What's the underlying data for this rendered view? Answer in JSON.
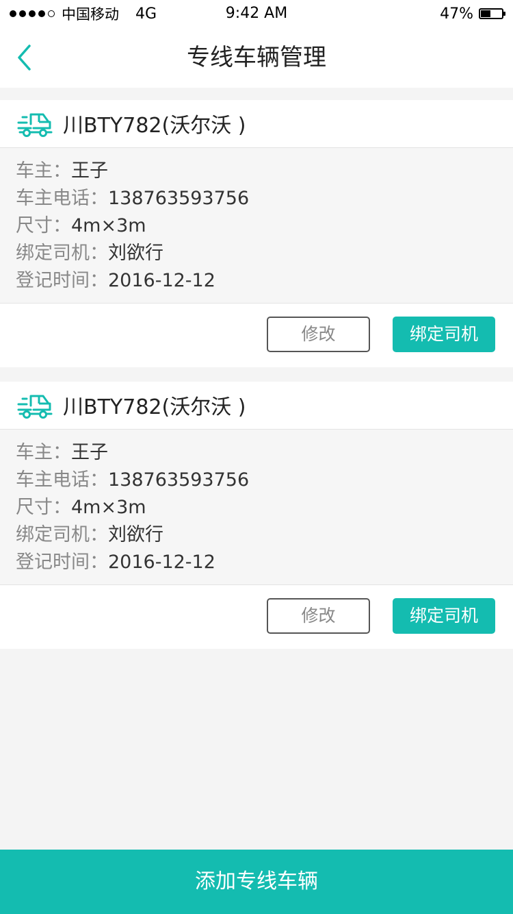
{
  "status_bar": {
    "carrier": "中国移动",
    "network": "4G",
    "time": "9:42 AM",
    "battery": "47%",
    "battery_level": 0.47,
    "signal_bars": 4,
    "signal_max": 5
  },
  "nav": {
    "back_icon": "chevron-left-icon",
    "title": "专线车辆管理"
  },
  "colors": {
    "accent": "#14bcb0",
    "page_background": "#f4f4f4"
  },
  "vehicles": [
    {
      "icon": "truck-icon",
      "plate": "川BTY782(沃尔沃 )",
      "fields": [
        {
          "label": "车主：",
          "value": "王子"
        },
        {
          "label": "车主电话：",
          "value": "138763593756"
        },
        {
          "label": "尺寸：",
          "value": "4m×3m"
        },
        {
          "label": "绑定司机：",
          "value": "刘欲行"
        },
        {
          "label": "登记时间：",
          "value": "2016-12-12"
        }
      ],
      "edit_label": "修改",
      "bind_label": "绑定司机"
    },
    {
      "icon": "truck-icon",
      "plate": "川BTY782(沃尔沃 )",
      "fields": [
        {
          "label": "车主：",
          "value": "王子"
        },
        {
          "label": "车主电话：",
          "value": "138763593756"
        },
        {
          "label": "尺寸：",
          "value": "4m×3m"
        },
        {
          "label": "绑定司机：",
          "value": "刘欲行"
        },
        {
          "label": "登记时间：",
          "value": "2016-12-12"
        }
      ],
      "edit_label": "修改",
      "bind_label": "绑定司机"
    }
  ],
  "footer": {
    "add_label": "添加专线车辆"
  }
}
